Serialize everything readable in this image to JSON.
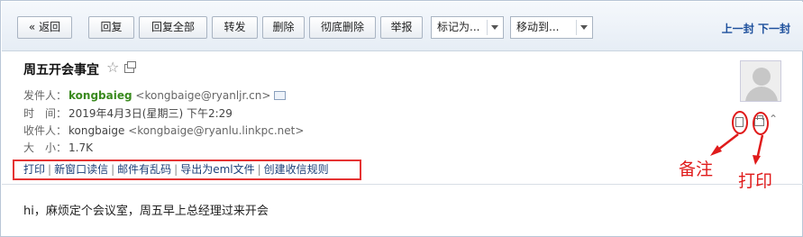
{
  "toolbar": {
    "back_label": "« 返回",
    "reply_label": "回复",
    "reply_all_label": "回复全部",
    "forward_label": "转发",
    "delete_label": "删除",
    "permanent_delete_label": "彻底删除",
    "report_label": "举报",
    "mark_as_label": "标记为...",
    "move_to_label": "移动到...",
    "prev_label": "上一封",
    "next_label": "下一封"
  },
  "email": {
    "subject": "周五开会事宜",
    "from_label": "发件人：",
    "from_name": "kongbaieg",
    "from_addr": "<kongbaige@ryanljr.cn>",
    "time_label": "时　间：",
    "time_value": "2019年4月3日(星期三) 下午2:29",
    "to_label": "收件人：",
    "to_name": "kongbaige",
    "to_addr": "<kongbaige@ryanlu.linkpc.net>",
    "size_label": "大　小：",
    "size_value": "1.7K",
    "body": "hi，麻烦定个会议室，周五早上总经理过来开会"
  },
  "actions": {
    "print": "打印",
    "new_window": "新窗口读信",
    "garbled": "邮件有乱码",
    "export_eml": "导出为eml文件",
    "create_rule": "创建收信规则",
    "separator": "|"
  },
  "annotations": {
    "note_label": "备注",
    "print_label": "打印",
    "color": "#e01b1b"
  },
  "icons": [
    "star-icon",
    "popout-icon",
    "vcard-icon",
    "avatar-icon",
    "note-icon",
    "print-icon",
    "collapse-icon"
  ]
}
